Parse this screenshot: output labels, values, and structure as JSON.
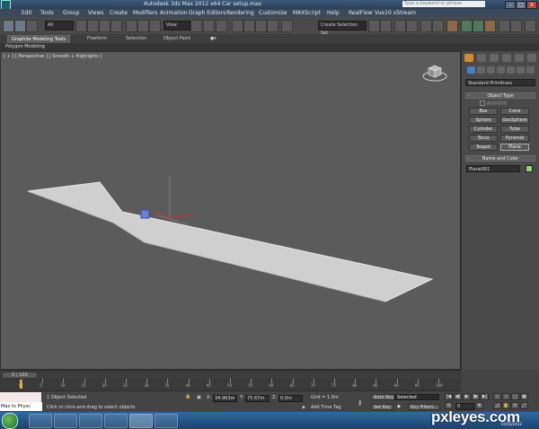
{
  "window": {
    "title": "Autodesk 3ds Max  2012 x64     Car setup.max",
    "search_placeholder": "Type a keyword or phrase"
  },
  "menu": [
    "Edit",
    "Tools",
    "Group",
    "Views",
    "Create",
    "Modifiers",
    "Animation",
    "Graph Editors",
    "Rendering",
    "Customize",
    "MAXScript",
    "Help",
    "RealFlow",
    "Vue10 xStream"
  ],
  "toolbar": {
    "view_dropdown": "View",
    "selection_set": "Create Selection Set"
  },
  "ribbon": {
    "tabs": [
      "Graphite Modeling Tools",
      "Freeform",
      "Selection",
      "Object Paint"
    ],
    "sub_tab": "Polygon Modeling"
  },
  "viewport": {
    "label": "[ + ] [ Perspective ] [ Smooth + Highlights ]"
  },
  "command_panel": {
    "dropdown": "Standard Primitives",
    "object_type": {
      "header": "Object Type",
      "autogrid": "AutoGrid",
      "buttons": [
        "Box",
        "Cone",
        "Sphere",
        "GeoSphere",
        "Cylinder",
        "Tube",
        "Torus",
        "Pyramid",
        "Teapot",
        "Plane"
      ]
    },
    "name_color": {
      "header": "Name and Color",
      "name": "Plane001",
      "color": "#8ed66f"
    }
  },
  "timeline": {
    "slider_label": "0 / 100",
    "ticks": [
      "0",
      "5",
      "10",
      "15",
      "20",
      "25",
      "30",
      "35",
      "40",
      "45",
      "50",
      "55",
      "60",
      "65",
      "70",
      "75",
      "80",
      "85",
      "90",
      "95",
      "100"
    ]
  },
  "status": {
    "maxscript_label": "Max to Physc",
    "objects_selected": "1 Object Selected",
    "prompt": "Click or click-and-drag to select objects",
    "x": "34.963m",
    "y": "75.67m",
    "z": "0.0m",
    "grid": "Grid = 1.0m",
    "add_time_tag": "Add Time Tag",
    "auto_key": "Auto Key",
    "selected": "Selected",
    "set_key": "Set Key",
    "key_filters": "Key Filters...",
    "frame": "0"
  },
  "watermark": {
    "brand": "pxleyes.com",
    "date": "05/03/2012"
  }
}
